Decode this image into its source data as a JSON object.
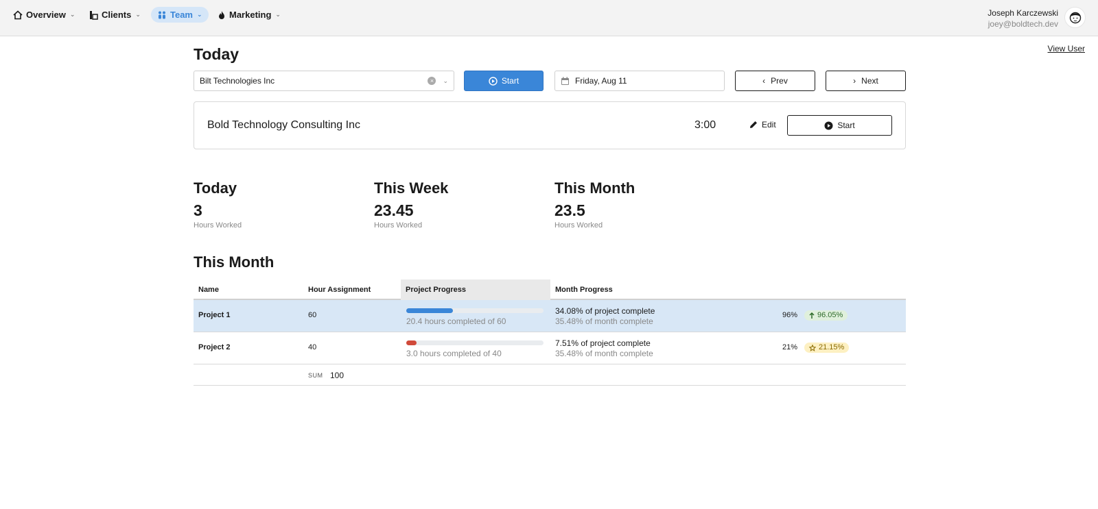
{
  "nav": {
    "items": [
      {
        "label": "Overview",
        "icon": "home-icon"
      },
      {
        "label": "Clients",
        "icon": "clients-icon"
      },
      {
        "label": "Team",
        "icon": "team-icon",
        "active": true
      },
      {
        "label": "Marketing",
        "icon": "flame-icon"
      }
    ],
    "active_color": "#3a86d8"
  },
  "user": {
    "name": "Joseph Karczewski",
    "email": "joey@boldtech.dev",
    "view_user_label": "View User"
  },
  "page": {
    "title": "Today"
  },
  "controls": {
    "client_value": "Bilt Technologies Inc",
    "start_label": "Start",
    "date_value": "Friday, Aug 11",
    "prev_label": "Prev",
    "next_label": "Next"
  },
  "timer": {
    "client": "Bold Technology Consulting Inc",
    "time": "3:00",
    "edit_label": "Edit",
    "start_label": "Start"
  },
  "stats": [
    {
      "title": "Today",
      "value": "3",
      "label": "Hours Worked"
    },
    {
      "title": "This Week",
      "value": "23.45",
      "label": "Hours Worked"
    },
    {
      "title": "This Month",
      "value": "23.5",
      "label": "Hours Worked"
    }
  ],
  "month_table": {
    "title": "This Month",
    "headers": [
      "Name",
      "Hour Assignment",
      "Project Progress",
      "Month Progress"
    ],
    "rows": [
      {
        "name": "Project 1",
        "hours": "60",
        "progress_fraction": 0.34,
        "progress_color": "#3a86d8",
        "progress_text": "20.4 hours completed of 60",
        "project_complete": "34.08% of project complete",
        "month_complete": "35.48% of month complete",
        "pct": "96%",
        "badge": "96.05%",
        "badge_icon": "arrow-up-icon",
        "selected": true
      },
      {
        "name": "Project 2",
        "hours": "40",
        "progress_fraction": 0.075,
        "progress_color": "#d04a3a",
        "progress_text": "3.0 hours completed of 40",
        "project_complete": "7.51% of project complete",
        "month_complete": "35.48% of month complete",
        "pct": "21%",
        "badge": "21.15%",
        "badge_icon": "star-icon",
        "selected": false
      }
    ],
    "sum_label": "SUM",
    "sum_value": "100"
  }
}
